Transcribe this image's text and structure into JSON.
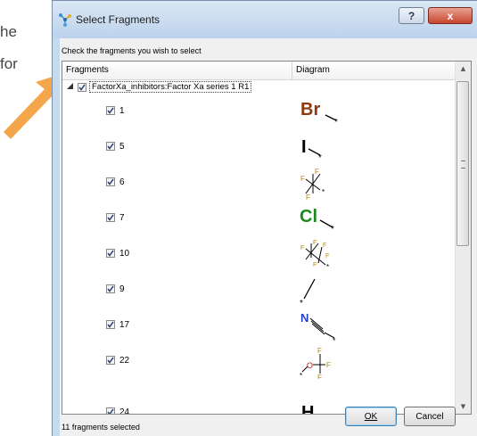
{
  "background": {
    "line1": "he",
    "line2": "for"
  },
  "dialog": {
    "title": "Select Fragments",
    "help_button": "?",
    "close_button": "x",
    "instruction": "Check the fragments you wish to select",
    "columns": {
      "fragments": "Fragments",
      "diagram": "Diagram"
    },
    "root": {
      "label": "FactorXa_inhibitors:Factor Xa series 1 R1",
      "checked": true
    },
    "fragments": [
      {
        "id": "1",
        "checked": true,
        "structure": "Br"
      },
      {
        "id": "5",
        "checked": true,
        "structure": "I"
      },
      {
        "id": "6",
        "checked": true,
        "structure": "CF3"
      },
      {
        "id": "7",
        "checked": true,
        "structure": "Cl"
      },
      {
        "id": "10",
        "checked": true,
        "structure": "C2F5"
      },
      {
        "id": "9",
        "checked": true,
        "structure": "methyl"
      },
      {
        "id": "17",
        "checked": true,
        "structure": "CN"
      },
      {
        "id": "22",
        "checked": true,
        "structure": "OCF3"
      },
      {
        "id": "24",
        "checked": true,
        "structure": "H"
      }
    ],
    "status": "11 fragments selected",
    "ok_label": "OK",
    "cancel_label": "Cancel",
    "colors": {
      "accent_arrow": "#f5a64b",
      "bromine": "#8b3a0f",
      "chlorine": "#1c8a1c",
      "fluorine": "#b8860b",
      "nitrogen": "#2340c8",
      "oxygen": "#d01010"
    }
  }
}
